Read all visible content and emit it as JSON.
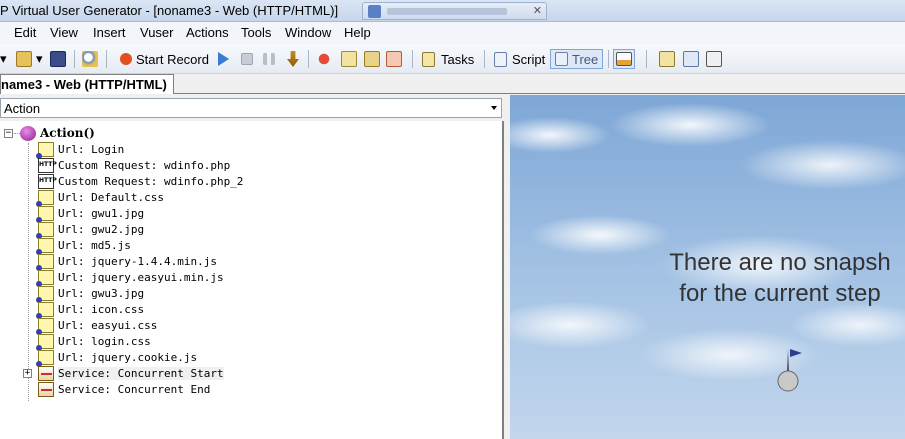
{
  "window": {
    "title": "P Virtual User Generator - [noname3 - Web (HTTP/HTML)]"
  },
  "menu": {
    "items": [
      "Edit",
      "View",
      "Insert",
      "Vuser",
      "Actions",
      "Tools",
      "Window",
      "Help"
    ]
  },
  "toolbar": {
    "start_record": "Start Record",
    "tasks": "Tasks",
    "script": "Script",
    "tree": "Tree"
  },
  "document_tab": {
    "label": "name3 - Web (HTTP/HTML)"
  },
  "action_selector": {
    "value": "Action"
  },
  "tree": {
    "root": "Action()",
    "steps": [
      {
        "kind": "url",
        "label": "Url: Login"
      },
      {
        "kind": "http",
        "label": "Custom Request: wdinfo.php"
      },
      {
        "kind": "http",
        "label": "Custom Request: wdinfo.php_2"
      },
      {
        "kind": "url",
        "label": "Url: Default.css"
      },
      {
        "kind": "url",
        "label": "Url: gwu1.jpg"
      },
      {
        "kind": "url",
        "label": "Url: gwu2.jpg"
      },
      {
        "kind": "url",
        "label": "Url: md5.js"
      },
      {
        "kind": "url",
        "label": "Url: jquery-1.4.4.min.js"
      },
      {
        "kind": "url",
        "label": "Url: jquery.easyui.min.js"
      },
      {
        "kind": "url",
        "label": "Url: gwu3.jpg"
      },
      {
        "kind": "url",
        "label": "Url: icon.css"
      },
      {
        "kind": "url",
        "label": "Url: easyui.css"
      },
      {
        "kind": "url",
        "label": "Url: login.css"
      },
      {
        "kind": "url",
        "label": "Url: jquery.cookie.js"
      },
      {
        "kind": "service",
        "label": "Service: Concurrent Start"
      },
      {
        "kind": "service",
        "label": "Service: Concurrent End"
      }
    ]
  },
  "snapshot": {
    "message_line1": "There are no snapsh",
    "message_line2": "for the current step"
  }
}
